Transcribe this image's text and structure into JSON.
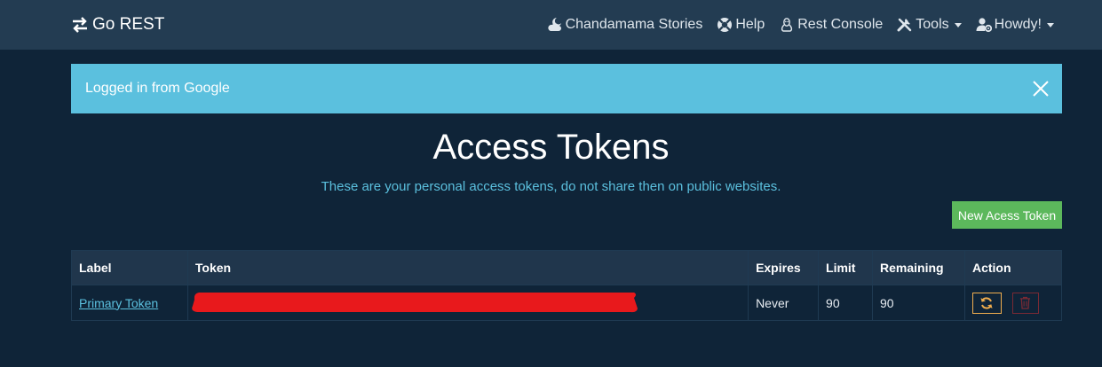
{
  "navbar": {
    "brand": "Go REST",
    "items": [
      {
        "label": "Chandamama Stories",
        "icon": "cloud-moon-icon",
        "dropdown": false
      },
      {
        "label": "Help",
        "icon": "lifebuoy-icon",
        "dropdown": false
      },
      {
        "label": "Rest Console",
        "icon": "linux-icon",
        "dropdown": false
      },
      {
        "label": "Tools",
        "icon": "tools-icon",
        "dropdown": true
      },
      {
        "label": "Howdy!",
        "icon": "user-cog-icon",
        "dropdown": true
      }
    ]
  },
  "alert": {
    "message": "Logged in from Google",
    "color": "#5bc0de"
  },
  "page": {
    "title": "Access Tokens",
    "subtitle": "These are your personal access tokens, do not share then on public websites.",
    "new_token_label": "New Acess Token"
  },
  "table": {
    "headers": [
      "Label",
      "Token",
      "Expires",
      "Limit",
      "Remaining",
      "Action"
    ],
    "rows": [
      {
        "label": "Primary Token",
        "token": "",
        "expires": "Never",
        "limit": "90",
        "remaining": "90"
      }
    ]
  },
  "colors": {
    "navbar_bg": "#233c52",
    "page_bg": "#0f2438",
    "success": "#5cb85c",
    "warning": "#f0ad4e",
    "danger": "#d9534f",
    "redaction": "#e8191c"
  }
}
